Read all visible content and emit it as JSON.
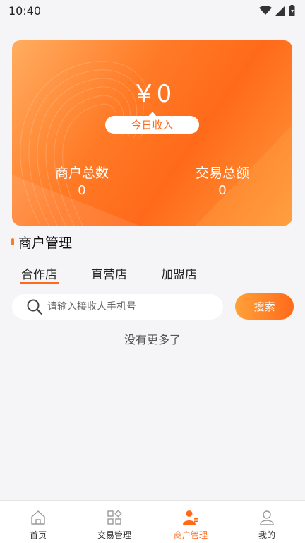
{
  "status_bar": {
    "time": "10:40"
  },
  "summary": {
    "amount": "￥0",
    "today_income_label": "今日收入",
    "merchant_count_label": "商户总数",
    "merchant_count_value": "0",
    "trade_total_label": "交易总额",
    "trade_total_value": "0"
  },
  "section": {
    "title": "商户管理"
  },
  "tabs": [
    {
      "label": "合作店",
      "active": true
    },
    {
      "label": "直营店",
      "active": false
    },
    {
      "label": "加盟店",
      "active": false
    }
  ],
  "search": {
    "placeholder": "请输入接收人手机号",
    "button_label": "搜索"
  },
  "list": {
    "empty_text": "没有更多了"
  },
  "tab_bar": {
    "items": [
      {
        "label": "首页",
        "icon": "home-icon",
        "active": false
      },
      {
        "label": "交易管理",
        "icon": "grid-icon",
        "active": false
      },
      {
        "label": "商户管理",
        "icon": "merchant-icon",
        "active": true
      },
      {
        "label": "我的",
        "icon": "user-icon",
        "active": false
      }
    ]
  },
  "colors": {
    "accent": "#ff6a1a",
    "background": "#f5f5f7"
  }
}
